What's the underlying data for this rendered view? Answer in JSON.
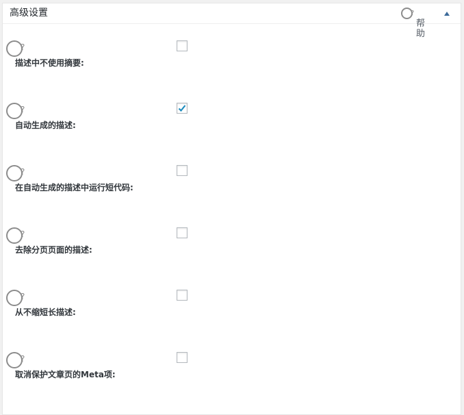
{
  "panel": {
    "title": "高级设置",
    "help_label": "帮助",
    "help_mark": "?",
    "toggle_icon": "triangle-up-icon",
    "accent_color": "#1e8cbe"
  },
  "options": [
    {
      "label": "描述中不使用摘要:",
      "help_mark": "?",
      "checked": false
    },
    {
      "label": "自动生成的描述:",
      "help_mark": "?",
      "checked": true
    },
    {
      "label": "在自动生成的描述中运行短代码:",
      "help_mark": "?",
      "checked": false
    },
    {
      "label": "去除分页页面的描述:",
      "help_mark": "?",
      "checked": false
    },
    {
      "label": "从不缩短长描述:",
      "help_mark": "?",
      "checked": false
    },
    {
      "label": "取消保护文章页的Meta项:",
      "help_mark": "?",
      "checked": false
    }
  ]
}
